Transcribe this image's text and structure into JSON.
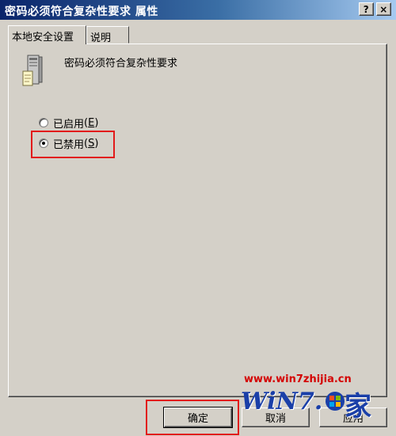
{
  "window": {
    "title": "密码必须符合复杂性要求 属性",
    "help_label": "?",
    "close_label": "×"
  },
  "tabs": [
    {
      "label": "本地安全设置",
      "active": true
    },
    {
      "label": "说明",
      "active": false
    }
  ],
  "policy": {
    "name": "密码必须符合复杂性要求",
    "icon": "server-policy-icon"
  },
  "options": [
    {
      "label": "已启用",
      "access_key": "E",
      "selected": false
    },
    {
      "label": "已禁用",
      "access_key": "S",
      "selected": true
    }
  ],
  "buttons": {
    "ok": "确定",
    "cancel": "取消",
    "apply": "应用"
  },
  "watermark": {
    "url": "www.win7zhijia.cn",
    "logo": "WiN7.",
    "char": "家"
  },
  "colors": {
    "highlight": "#e21a1a",
    "face": "#d4d0c8",
    "title_start": "#0a246a",
    "title_end": "#a6caf0"
  }
}
